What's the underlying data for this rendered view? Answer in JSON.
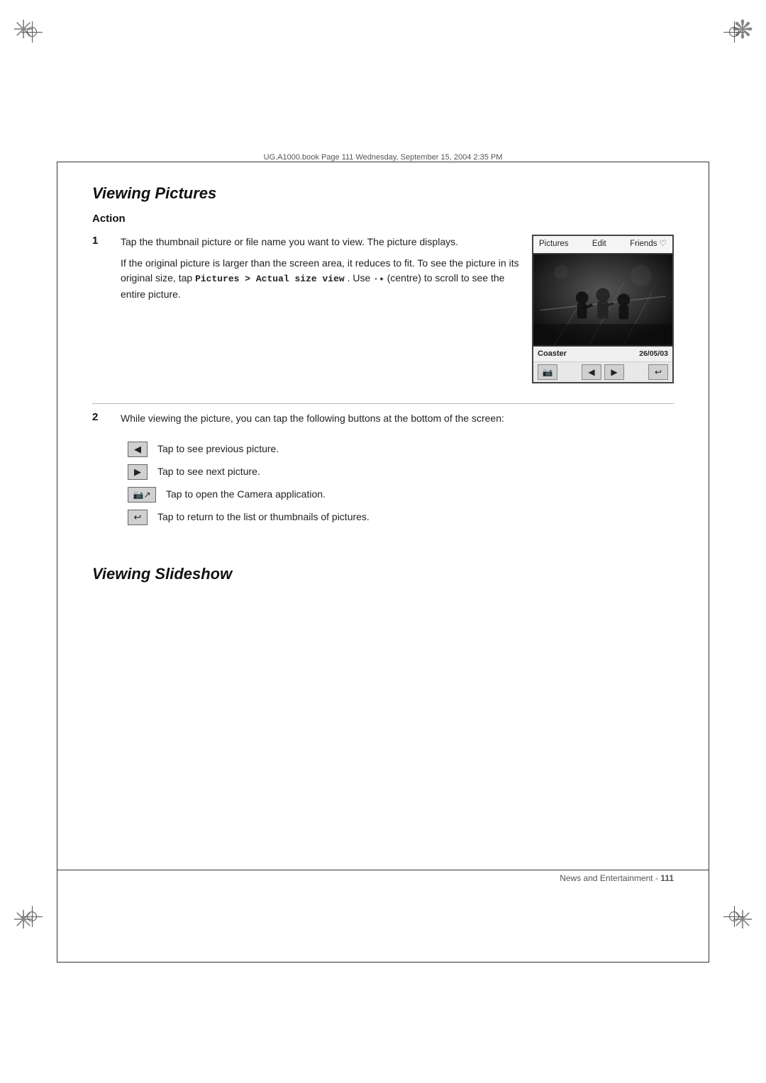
{
  "header": {
    "text": "UG.A1000.book  Page 111  Wednesday, September 15, 2004  2:35 PM"
  },
  "footer": {
    "text": "News and Entertainment - ",
    "page": "111"
  },
  "section1": {
    "title": "Viewing Pictures",
    "action_label": "Action",
    "step1": {
      "number": "1",
      "para1": "Tap the thumbnail picture or file name you want to view. The picture displays.",
      "para2": "If the original picture is larger than the screen area, it reduces to fit. To see the picture in its original size, tap",
      "inline1": "Pictures > Actual size view",
      "para3": ". Use",
      "inline2": "·✦",
      "para4": " (centre) to scroll to see the entire picture."
    },
    "screen": {
      "menu_pictures": "Pictures",
      "menu_edit": "Edit",
      "menu_friends": "Friends ♡",
      "footer_name": "Coaster",
      "footer_date": "26/05/03"
    },
    "step2": {
      "number": "2",
      "para": "While viewing the picture, you can tap the following buttons at the bottom of the screen:",
      "buttons": [
        {
          "icon": "◀",
          "description": "Tap to see previous picture."
        },
        {
          "icon": "▶",
          "description": "Tap to see next picture."
        },
        {
          "icon": "📷↗",
          "description": "Tap to open the Camera application.",
          "wide": true
        },
        {
          "icon": "↩",
          "description": "Tap to return to the list or thumbnails of pictures."
        }
      ]
    }
  },
  "section2": {
    "title": "Viewing Slideshow"
  }
}
